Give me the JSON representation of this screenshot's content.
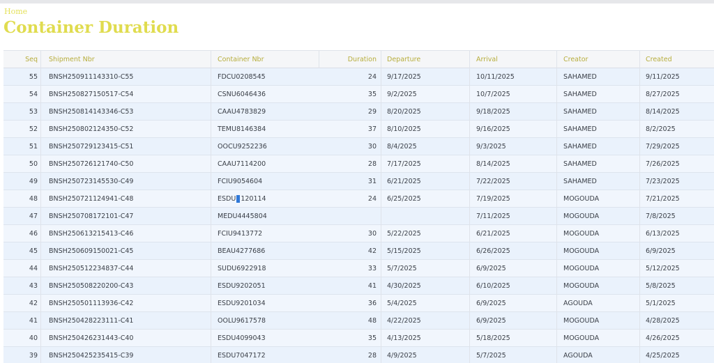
{
  "window": {
    "title": "Container Duration"
  },
  "breadcrumb": {
    "home": "Home"
  },
  "page": {
    "title": "Container Duration"
  },
  "table": {
    "columns": {
      "seq": "Seq",
      "shipment": "Shipment Nbr",
      "container": "Container Nbr",
      "duration": "Duration",
      "departure": "Departure",
      "arrival": "Arrival",
      "creator": "Creator",
      "created": "Created"
    },
    "rows": [
      {
        "seq": "55",
        "shipment": "BNSH250911143310-C55",
        "container": "FDCU0208545",
        "duration": "24",
        "departure": "9/17/2025",
        "arrival": "10/11/2025",
        "creator": "SAHAMED",
        "created": "9/11/2025"
      },
      {
        "seq": "54",
        "shipment": "BNSH250827150517-C54",
        "container": "CSNU6046436",
        "duration": "35",
        "departure": "9/2/2025",
        "arrival": "10/7/2025",
        "creator": "SAHAMED",
        "created": "8/27/2025"
      },
      {
        "seq": "53",
        "shipment": "BNSH250814143346-C53",
        "container": "CAAU4783829",
        "duration": "29",
        "departure": "8/20/2025",
        "arrival": "9/18/2025",
        "creator": "SAHAMED",
        "created": "8/14/2025"
      },
      {
        "seq": "52",
        "shipment": "BNSH250802124350-C52",
        "container": "TEMU8146384",
        "duration": "37",
        "departure": "8/10/2025",
        "arrival": "9/16/2025",
        "creator": "SAHAMED",
        "created": "8/2/2025"
      },
      {
        "seq": "51",
        "shipment": "BNSH250729123415-C51",
        "container": "OOCU9252236",
        "duration": "30",
        "departure": "8/4/2025",
        "arrival": "9/3/2025",
        "creator": "SAHAMED",
        "created": "7/29/2025"
      },
      {
        "seq": "50",
        "shipment": "BNSH250726121740-C50",
        "container": "CAAU7114200",
        "duration": "28",
        "departure": "7/17/2025",
        "arrival": "8/14/2025",
        "creator": "SAHAMED",
        "created": "7/26/2025"
      },
      {
        "seq": "49",
        "shipment": "BNSH250723145530-C49",
        "container": "FCIU9054604",
        "duration": "31",
        "departure": "6/21/2025",
        "arrival": "7/22/2025",
        "creator": "SAHAMED",
        "created": "7/23/2025"
      },
      {
        "seq": "48",
        "shipment": "BNSH250721124941-C48",
        "container_pre": "ESDU",
        "container_post": "120114",
        "duration": "24",
        "departure": "6/25/2025",
        "arrival": "7/19/2025",
        "creator": "MOGOUDA",
        "created": "7/21/2025"
      },
      {
        "seq": "47",
        "shipment": "BNSH250708172101-C47",
        "container": "MEDU4445804",
        "duration": "",
        "departure": "",
        "arrival": "7/11/2025",
        "creator": "MOGOUDA",
        "created": "7/8/2025"
      },
      {
        "seq": "46",
        "shipment": "BNSH250613215413-C46",
        "container": "FCIU9413772",
        "duration": "30",
        "departure": "5/22/2025",
        "arrival": "6/21/2025",
        "creator": "MOGOUDA",
        "created": "6/13/2025"
      },
      {
        "seq": "45",
        "shipment": "BNSH250609150021-C45",
        "container": "BEAU4277686",
        "duration": "42",
        "departure": "5/15/2025",
        "arrival": "6/26/2025",
        "creator": "MOGOUDA",
        "created": "6/9/2025"
      },
      {
        "seq": "44",
        "shipment": "BNSH250512234837-C44",
        "container": "SUDU6922918",
        "duration": "33",
        "departure": "5/7/2025",
        "arrival": "6/9/2025",
        "creator": "MOGOUDA",
        "created": "5/12/2025"
      },
      {
        "seq": "43",
        "shipment": "BNSH250508220200-C43",
        "container": "ESDU9202051",
        "duration": "41",
        "departure": "4/30/2025",
        "arrival": "6/10/2025",
        "creator": "MOGOUDA",
        "created": "5/8/2025"
      },
      {
        "seq": "42",
        "shipment": "BNSH250501113936-C42",
        "container": "ESDU9201034",
        "duration": "36",
        "departure": "5/4/2025",
        "arrival": "6/9/2025",
        "creator": "AGOUDA",
        "created": "5/1/2025"
      },
      {
        "seq": "41",
        "shipment": "BNSH250428223111-C41",
        "container": "OOLU9617578",
        "duration": "48",
        "departure": "4/22/2025",
        "arrival": "6/9/2025",
        "creator": "MOGOUDA",
        "created": "4/28/2025"
      },
      {
        "seq": "40",
        "shipment": "BNSH250426231443-C40",
        "container": "ESDU4099043",
        "duration": "35",
        "departure": "4/13/2025",
        "arrival": "5/18/2025",
        "creator": "MOGOUDA",
        "created": "4/26/2025"
      },
      {
        "seq": "39",
        "shipment": "BNSH250425235415-C39",
        "container": "ESDU7047172",
        "duration": "28",
        "departure": "4/9/2025",
        "arrival": "5/7/2025",
        "creator": "AGOUDA",
        "created": "4/25/2025"
      }
    ]
  }
}
